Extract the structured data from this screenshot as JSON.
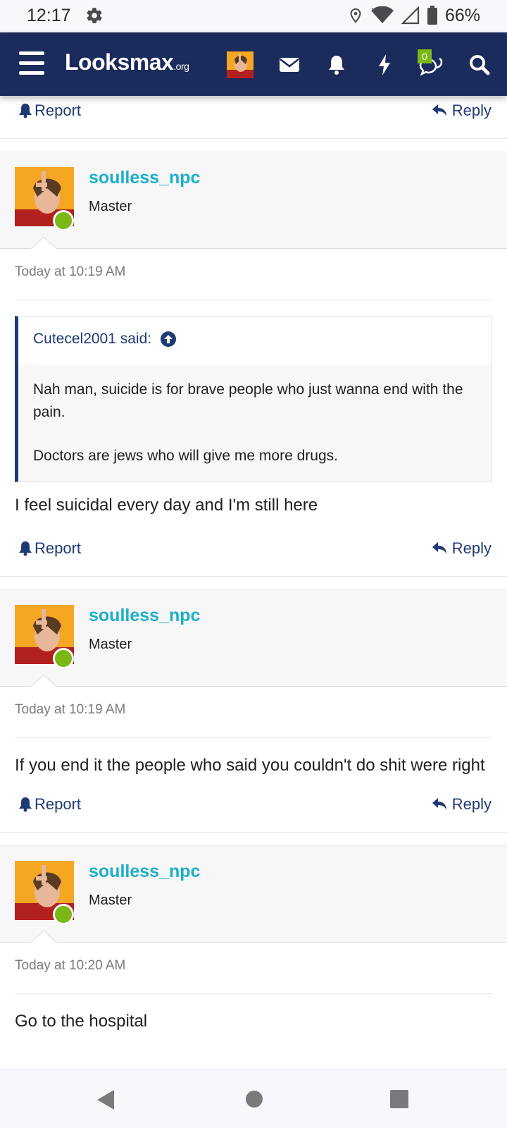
{
  "status_bar": {
    "time": "12:17",
    "battery": "66%"
  },
  "nav": {
    "logo_main": "Looksmax",
    "logo_suffix": ".org",
    "conversations_badge": "0"
  },
  "top_actions": {
    "report_label": "Report",
    "reply_label": "Reply"
  },
  "posts": [
    {
      "username": "soulless_npc",
      "rank": "Master",
      "date": "Today at 10:19 AM",
      "quote": {
        "author": "Cutecel2001 said:",
        "lines": [
          "Nah man, suicide is for brave people who just wanna end with the pain.",
          "Doctors are jews who will give me more drugs."
        ]
      },
      "body": "I feel suicidal every day and I'm still here",
      "report_label": "Report",
      "reply_label": "Reply"
    },
    {
      "username": "soulless_npc",
      "rank": "Master",
      "date": "Today at 10:19 AM",
      "body": "If you end it the people who said you couldn't do shit were right",
      "report_label": "Report",
      "reply_label": "Reply"
    },
    {
      "username": "soulless_npc",
      "rank": "Master",
      "date": "Today at 10:20 AM",
      "body": "Go to the hospital"
    }
  ],
  "colors": {
    "nav_bg": "#1a2b5c",
    "username": "#1ab0c9",
    "link": "#1e3a73",
    "online": "#7bb716"
  }
}
